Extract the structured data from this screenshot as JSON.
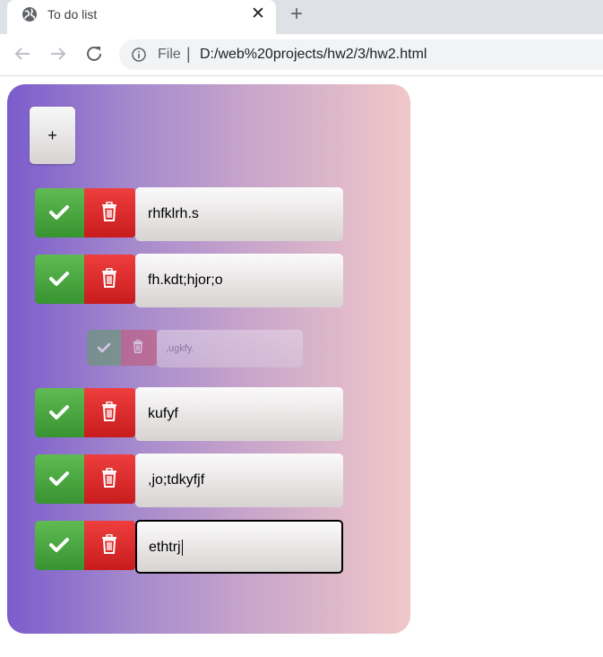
{
  "browser": {
    "tab_title": "To do list",
    "tab_close_glyph": "✕",
    "new_tab_glyph": "+",
    "scheme_label": "File",
    "separator": "|",
    "url": "D:/web%20projects/hw2/3/hw2.html",
    "icons": [
      "globe-icon",
      "back-arrow-icon",
      "forward-arrow-icon",
      "reload-icon",
      "info-icon"
    ]
  },
  "app": {
    "add_button_label": "+",
    "tasks": [
      {
        "text": "rhfklrh.s",
        "state": "normal"
      },
      {
        "text": "fh.kdt;hjor;o",
        "state": "normal"
      },
      {
        "text": ",ugkfy.",
        "state": "completed-fading"
      },
      {
        "text": "kufyf",
        "state": "normal"
      },
      {
        "text": ",jo;tdkyfjf",
        "state": "normal"
      },
      {
        "text": "ethtrj",
        "state": "editing"
      }
    ],
    "icons": {
      "done": "check-icon",
      "delete": "trash-icon"
    },
    "colors": {
      "gradient_start": "#7b5ccc",
      "gradient_end": "#f0c8c8",
      "done_green": "#379430",
      "delete_red": "#c81c1c"
    }
  }
}
